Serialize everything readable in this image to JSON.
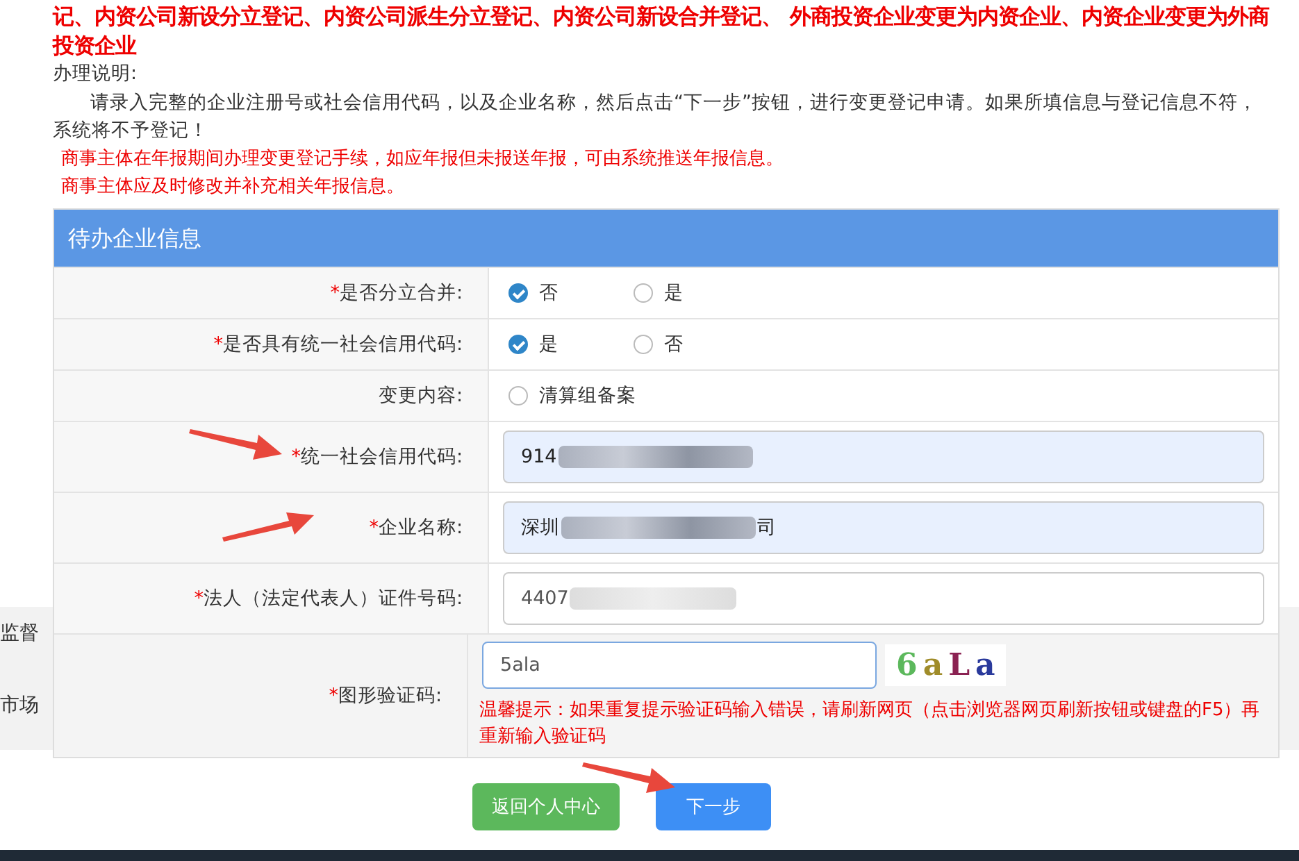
{
  "notice": {
    "text": "记、内资公司新设分立登记、内资公司派生分立登记、内资公司新设合并登记、 外商投资企业变更为内资企业、内资企业变更为外商投资企业"
  },
  "instructions": {
    "title": "办理说明:",
    "body": "请录入完整的企业注册号或社会信用代码，以及企业名称，然后点击“下一步”按钮，进行变更登记申请。如果所填信息与登记信息不符，系统将不予登记！",
    "warnings": [
      "商事主体在年报期间办理变更登记手续，如应年报但未报送年报，可由系统推送年报信息。",
      "商事主体应及时修改并补充相关年报信息。"
    ]
  },
  "background_page": {
    "texts": [
      "监督",
      "市场"
    ]
  },
  "panel": {
    "title": "待办企业信息",
    "rows": [
      {
        "kind": "radio",
        "label": "是否分立合并:",
        "required_mark": "*",
        "options": [
          {
            "label": "否",
            "selected": true
          },
          {
            "label": "是",
            "selected": false
          }
        ]
      },
      {
        "kind": "radio",
        "label": "是否具有统一社会信用代码:",
        "required_mark": "*",
        "options": [
          {
            "label": "是",
            "selected": true
          },
          {
            "label": "否",
            "selected": false
          }
        ]
      },
      {
        "kind": "checkbox",
        "label": "变更内容:",
        "options": [
          {
            "label": "清算组备案",
            "selected": false
          }
        ]
      },
      {
        "kind": "input",
        "label": "统一社会信用代码:",
        "required_mark": "*",
        "value": "914",
        "autofilled": true
      },
      {
        "kind": "input",
        "label": "企业名称:",
        "required_mark": "*",
        "value": "深圳",
        "value_end": "司",
        "autofilled": true
      },
      {
        "kind": "input",
        "label": "法人（法定代表人）证件号码:",
        "required_mark": "*",
        "value": "4407",
        "autofilled": false
      },
      {
        "kind": "captcha",
        "label": "图形验证码:",
        "required_mark": "*",
        "value": "5ala",
        "captcha": [
          {
            "char": "6",
            "color": "#5cb85c"
          },
          {
            "char": "a",
            "color": "#a08c2a"
          },
          {
            "char": "L",
            "color": "#8b2252"
          },
          {
            "char": "a",
            "color": "#2a3a9c"
          }
        ],
        "hint": "温馨提示：如果重复提示验证码输入错误，请刷新网页（点击浏览器网页刷新按钮或键盘的F5）再重新输入验证码"
      }
    ]
  },
  "buttons": [
    {
      "label": "返回个人中心",
      "kind": "secondary"
    },
    {
      "label": "下一步",
      "kind": "primary"
    }
  ]
}
